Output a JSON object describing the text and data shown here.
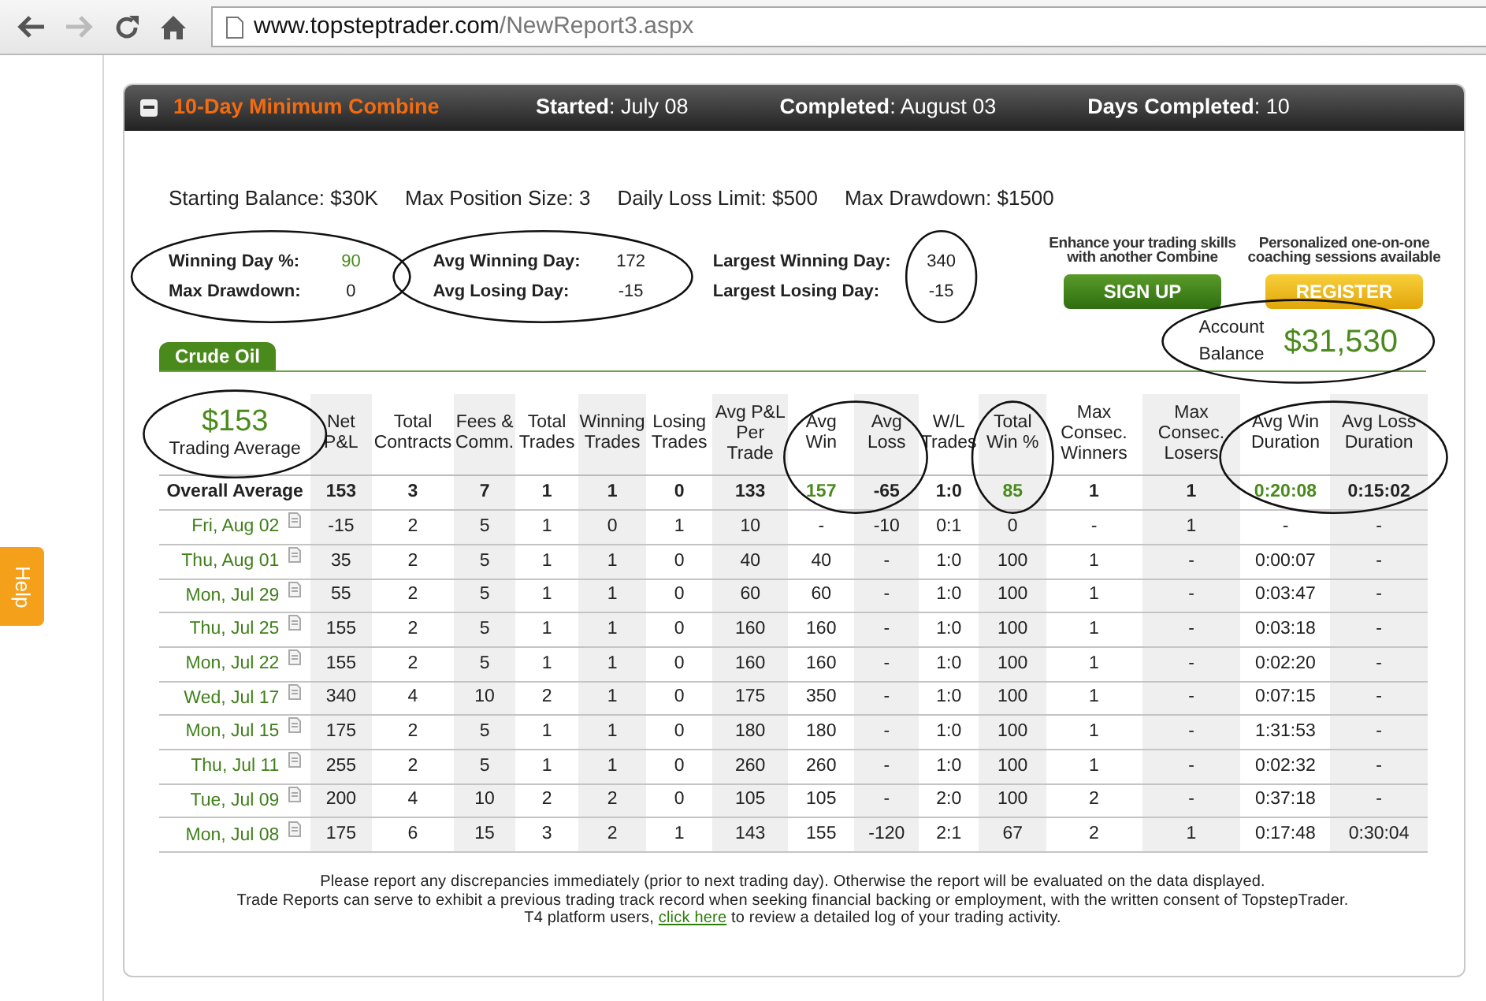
{
  "browser": {
    "address_host": "www.topsteptrader.com",
    "address_path": "/NewReport3.aspx"
  },
  "help_tab": {
    "label": "Help"
  },
  "header": {
    "title": "10-Day Minimum Combine",
    "fields": [
      {
        "label": "Started",
        "value": ": July 08"
      },
      {
        "label": "Completed",
        "value": ": August 03"
      },
      {
        "label": "Days Completed",
        "value": ": 10"
      }
    ]
  },
  "limits": [
    "Starting Balance: $30K",
    "Max Position Size: 3",
    "Daily Loss Limit: $500",
    "Max Drawdown: $1500"
  ],
  "stat_groups": [
    {
      "items": [
        {
          "label": "Winning Day %:",
          "value": "90",
          "highlight": true
        },
        {
          "label": "Max Drawdown:",
          "value": "0",
          "highlight": false
        }
      ]
    },
    {
      "items": [
        {
          "label": "Avg Winning Day:",
          "value": "172",
          "highlight": false
        },
        {
          "label": "Avg Losing Day:",
          "value": "-15",
          "highlight": false
        }
      ]
    },
    {
      "items": [
        {
          "label": "Largest Winning Day:",
          "value": "340",
          "highlight": false
        },
        {
          "label": "Largest Losing Day:",
          "value": "-15",
          "highlight": false
        }
      ]
    }
  ],
  "promos": [
    {
      "text": "Enhance your trading skills with another Combine",
      "button": "SIGN UP",
      "kind": "green"
    },
    {
      "text": "Personalized one-on-one coaching sessions available",
      "button": "REGISTER",
      "kind": "yellow"
    }
  ],
  "tabs": [
    {
      "label": "Crude Oil",
      "selected": true
    }
  ],
  "account": {
    "label": "Account Balance",
    "value": "$31,530"
  },
  "trading_average": {
    "value": "$153",
    "label": "Trading Average"
  },
  "table": {
    "columns": [
      "Net P&L",
      "Total Contracts",
      "Fees & Comm.",
      "Total Trades",
      "Winning Trades",
      "Losing Trades",
      "Avg P&L Per Trade",
      "Avg Win",
      "Avg Loss",
      "W/L Trades",
      "Total Win %",
      "Max Consec. Winners",
      "Max Consec. Losers",
      "Avg Win Duration",
      "Avg Loss Duration"
    ],
    "overall": {
      "label": "Overall Average",
      "cells": [
        {
          "text": "153",
          "highlight": false
        },
        {
          "text": "3",
          "highlight": false
        },
        {
          "text": "7",
          "highlight": false
        },
        {
          "text": "1",
          "highlight": false
        },
        {
          "text": "1",
          "highlight": false
        },
        {
          "text": "0",
          "highlight": false
        },
        {
          "text": "133",
          "highlight": false
        },
        {
          "text": "157",
          "highlight": true
        },
        {
          "text": "-65",
          "highlight": false
        },
        {
          "text": "1:0",
          "highlight": false
        },
        {
          "text": "85",
          "highlight": true
        },
        {
          "text": "1",
          "highlight": false
        },
        {
          "text": "1",
          "highlight": false
        },
        {
          "text": "0:20:08",
          "highlight": true
        },
        {
          "text": "0:15:02",
          "highlight": false
        }
      ]
    },
    "rows": [
      {
        "date": "Fri, Aug 02",
        "cells": [
          "-15",
          "2",
          "5",
          "1",
          "0",
          "1",
          "10",
          "-",
          "-10",
          "0:1",
          "0",
          "-",
          "1",
          "-",
          "-"
        ]
      },
      {
        "date": "Thu, Aug 01",
        "cells": [
          "35",
          "2",
          "5",
          "1",
          "1",
          "0",
          "40",
          "40",
          "-",
          "1:0",
          "100",
          "1",
          "-",
          "0:00:07",
          "-"
        ]
      },
      {
        "date": "Mon, Jul 29",
        "cells": [
          "55",
          "2",
          "5",
          "1",
          "1",
          "0",
          "60",
          "60",
          "-",
          "1:0",
          "100",
          "1",
          "-",
          "0:03:47",
          "-"
        ]
      },
      {
        "date": "Thu, Jul 25",
        "cells": [
          "155",
          "2",
          "5",
          "1",
          "1",
          "0",
          "160",
          "160",
          "-",
          "1:0",
          "100",
          "1",
          "-",
          "0:03:18",
          "-"
        ]
      },
      {
        "date": "Mon, Jul 22",
        "cells": [
          "155",
          "2",
          "5",
          "1",
          "1",
          "0",
          "160",
          "160",
          "-",
          "1:0",
          "100",
          "1",
          "-",
          "0:02:20",
          "-"
        ]
      },
      {
        "date": "Wed, Jul 17",
        "cells": [
          "340",
          "4",
          "10",
          "2",
          "1",
          "0",
          "175",
          "350",
          "-",
          "1:0",
          "100",
          "1",
          "-",
          "0:07:15",
          "-"
        ]
      },
      {
        "date": "Mon, Jul 15",
        "cells": [
          "175",
          "2",
          "5",
          "1",
          "1",
          "0",
          "180",
          "180",
          "-",
          "1:0",
          "100",
          "1",
          "-",
          "1:31:53",
          "-"
        ]
      },
      {
        "date": "Thu, Jul 11",
        "cells": [
          "255",
          "2",
          "5",
          "1",
          "1",
          "0",
          "260",
          "260",
          "-",
          "1:0",
          "100",
          "1",
          "-",
          "0:02:32",
          "-"
        ]
      },
      {
        "date": "Tue, Jul 09",
        "cells": [
          "200",
          "4",
          "10",
          "2",
          "2",
          "0",
          "105",
          "105",
          "-",
          "2:0",
          "100",
          "2",
          "-",
          "0:37:18",
          "-"
        ]
      },
      {
        "date": "Mon, Jul 08",
        "cells": [
          "175",
          "6",
          "15",
          "3",
          "2",
          "1",
          "143",
          "155",
          "-120",
          "2:1",
          "67",
          "2",
          "1",
          "0:17:48",
          "0:30:04"
        ]
      }
    ]
  },
  "footer": {
    "lines": [
      "Please report any discrepancies immediately (prior to next trading day). Otherwise the report will be evaluated on the data displayed.",
      "Trade Reports can serve to exhibit a previous trading track record when seeking financial backing or employment, with the written consent of TopstepTrader."
    ],
    "last_prefix": "T4 platform users, ",
    "link": "click here",
    "last_suffix": " to review a detailed log of your trading activity."
  }
}
